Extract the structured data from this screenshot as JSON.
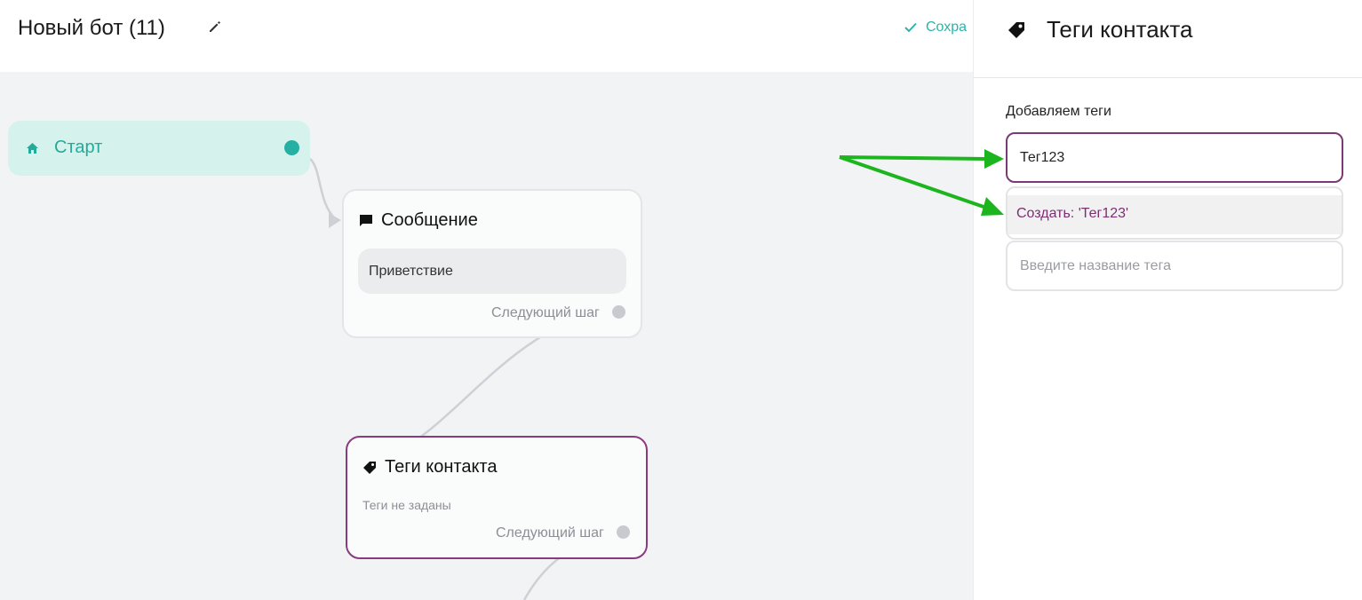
{
  "header": {
    "bot_title": "Новый бот (11)",
    "save_status": "Сохра"
  },
  "canvas": {
    "start_node": {
      "label": "Старт"
    },
    "message_node": {
      "title": "Сообщение",
      "content": "Приветствие",
      "next_step": "Следующий шаг"
    },
    "tags_node": {
      "title": "Теги контакта",
      "empty_text": "Теги не заданы",
      "next_step": "Следующий шаг"
    }
  },
  "panel": {
    "title": "Теги контакта",
    "field_label": "Добавляем теги",
    "tag_input_value": "Тег123",
    "suggestion": "Создать: 'Тег123'",
    "tag_name_placeholder": "Введите название тега"
  },
  "colors": {
    "accent_teal": "#25b0a3",
    "accent_purple": "#7b3a73",
    "annotation_green": "#1db51d"
  },
  "icons": [
    "edit-icon",
    "check-icon",
    "home-icon",
    "message-icon",
    "tag-icon"
  ]
}
